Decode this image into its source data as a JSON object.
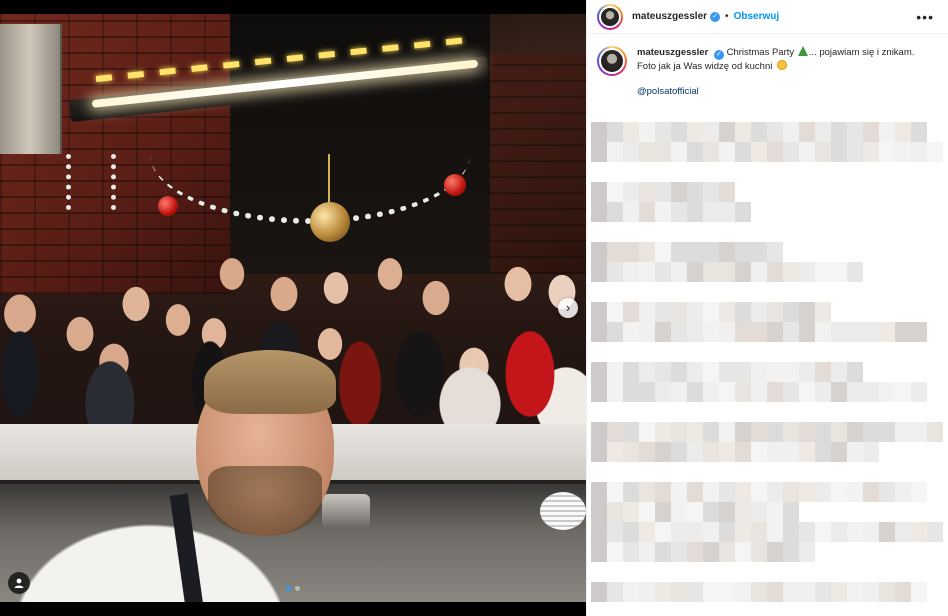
{
  "post": {
    "username": "mateuszgessler",
    "follow_label": "Obserwuj",
    "more_label": "•••",
    "separator": "•",
    "caption": {
      "username": "mateuszgessler",
      "text_part1": "Christmas Party",
      "text_part2": "... pojawiam się i znikam.",
      "text_line2": "Foto jak ja Was widzę od kuchni",
      "mention": "@polsatofficial"
    }
  },
  "media": {
    "next_arrow": "›",
    "carousel": {
      "count": 2,
      "active_index": 0
    }
  },
  "icons": {
    "header_avatar": "profile-avatar-icon",
    "verified": "verified-badge-icon",
    "more": "more-options-icon",
    "tree": "christmas-tree-emoji-icon",
    "smile": "smiling-face-emoji-icon",
    "user_tag": "user-tag-icon",
    "next": "chevron-right-icon"
  },
  "colors": {
    "accent": "#0095f6",
    "verified": "#3897f0",
    "text": "#262626",
    "mention": "#00376b"
  }
}
